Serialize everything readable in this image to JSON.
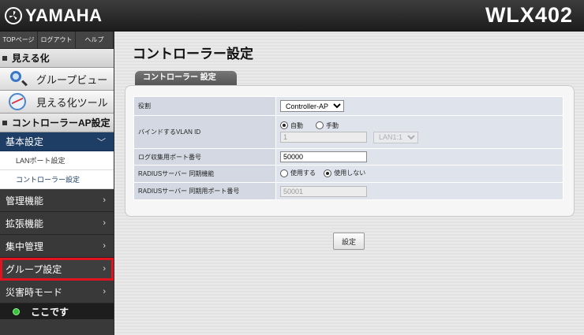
{
  "header": {
    "brand": "YAMAHA",
    "model": "WLX402"
  },
  "topnav": [
    "TOPページ",
    "ログアウト",
    "ヘルプ"
  ],
  "sidebar": {
    "section_visualize": "見える化",
    "group_view": "グループビュー",
    "visualize_tool": "見える化ツール",
    "section_controller": "コントローラーAP設定",
    "basic": "基本設定",
    "lan_port": "LANポート設定",
    "controller_settings": "コントローラー設定",
    "management": "管理機能",
    "extensions": "拡張機能",
    "central": "集中管理",
    "group_settings": "グループ設定",
    "disaster": "災害時モード",
    "here": "ここです"
  },
  "main": {
    "title": "コントローラー設定",
    "tab": "コントローラー 設定",
    "rows": {
      "role_label": "役割",
      "role_value": "Controller-AP",
      "vlan_label": "バインドするVLAN ID",
      "vlan_auto": "自動",
      "vlan_manual": "手動",
      "vlan_id_value": "1",
      "vlan_port_value": "LAN1:1",
      "log_port_label": "ログ収集用ポート番号",
      "log_port_value": "50000",
      "radius_label": "RADIUSサーバー 同期機能",
      "radius_use": "使用する",
      "radius_nouse": "使用しない",
      "radius_port_label": "RADIUSサーバー 同期用ポート番号",
      "radius_port_value": "50001"
    },
    "submit": "設定"
  }
}
